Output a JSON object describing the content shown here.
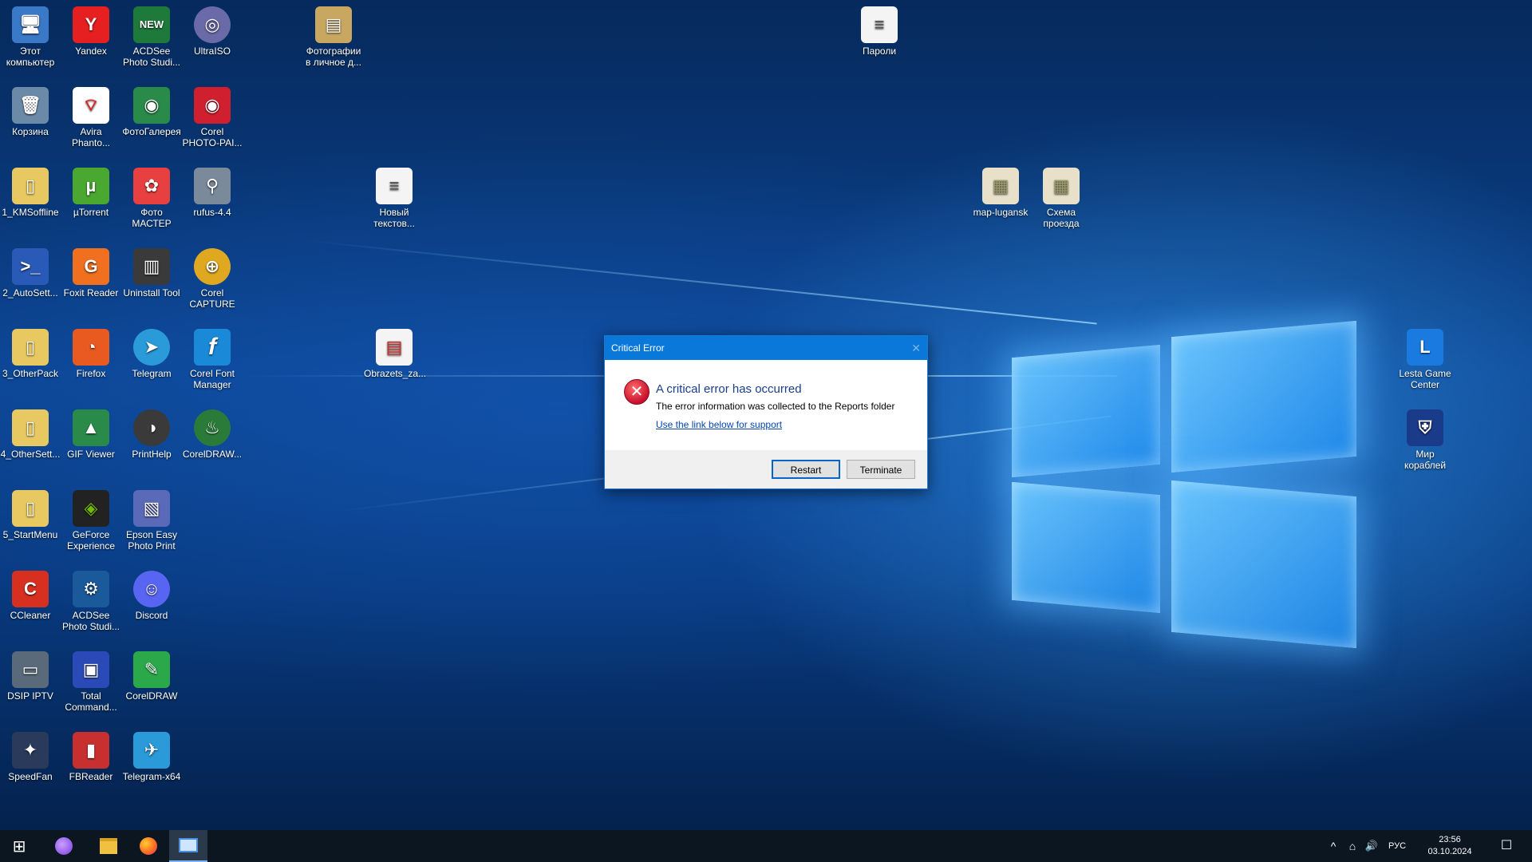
{
  "desktop": {
    "icons": [
      {
        "label": "Этот компьютер",
        "glyph": "🖥",
        "color": "#3a78c8"
      },
      {
        "label": "Yandex",
        "glyph": "Y",
        "color": "#e62020"
      },
      {
        "label": "ACDSee Photo Studi...",
        "glyph": "NEW",
        "color": "#1e7a3a"
      },
      {
        "label": "UltraISO",
        "glyph": "◎",
        "color": "#6a6aa8"
      },
      {
        "label": "Фотографии в личное д...",
        "glyph": "▤",
        "color": "#c8a860"
      },
      {
        "label": "Пароли",
        "glyph": "≡",
        "color": "#f4f4f4"
      },
      {
        "label": "Корзина",
        "glyph": "🗑",
        "color": "#6a8aa8"
      },
      {
        "label": "Avira Phanto...",
        "glyph": "⌔",
        "color": "#ffffff"
      },
      {
        "label": "ФотоГалерея",
        "glyph": "◉",
        "color": "#2a8a4a"
      },
      {
        "label": "Corel PHOTO-PAI...",
        "glyph": "◉",
        "color": "#d02030"
      },
      {
        "label": "1_KMSoffline",
        "glyph": "▯",
        "color": "#e8c860"
      },
      {
        "label": "µTorrent",
        "glyph": "µ",
        "color": "#4aa830"
      },
      {
        "label": "Фото МАСТЕР",
        "glyph": "✿",
        "color": "#e84040"
      },
      {
        "label": "rufus-4.4",
        "glyph": "⚲",
        "color": "#7a8a9a"
      },
      {
        "label": "Новый текстов...",
        "glyph": "≡",
        "color": "#f4f4f4"
      },
      {
        "label": "map-lugansk",
        "glyph": "▦",
        "color": "#e8e0c8"
      },
      {
        "label": "Схема проезда",
        "glyph": "▦",
        "color": "#e8e0c8"
      },
      {
        "label": "2_AutoSett...",
        "glyph": ">_",
        "color": "#2a5ab8"
      },
      {
        "label": "Foxit Reader",
        "glyph": "G",
        "color": "#f07020"
      },
      {
        "label": "Uninstall Tool",
        "glyph": "▥",
        "color": "#3a3a3a"
      },
      {
        "label": "Corel CAPTURE",
        "glyph": "⊕",
        "color": "#e0a820"
      },
      {
        "label": "3_OtherPack",
        "glyph": "▯",
        "color": "#e8c860"
      },
      {
        "label": "Firefox",
        "glyph": "◔",
        "color": "#e85a20"
      },
      {
        "label": "Telegram",
        "glyph": "➤",
        "color": "#2a9ad8"
      },
      {
        "label": "Corel Font Manager",
        "glyph": "f",
        "color": "#1a8ad8"
      },
      {
        "label": "Obrazets_za...",
        "glyph": "▤",
        "color": "#f4f4f4"
      },
      {
        "label": "Lesta Game Center",
        "glyph": "L",
        "color": "#1a7ae0"
      },
      {
        "label": "4_OtherSett...",
        "glyph": "▯",
        "color": "#e8c860"
      },
      {
        "label": "GIF Viewer",
        "glyph": "▲",
        "color": "#2a8a4a"
      },
      {
        "label": "PrintHelp",
        "glyph": "◑",
        "color": "#3a3a3a"
      },
      {
        "label": "CorelDRAW...",
        "glyph": "♨",
        "color": "#2a7a3a"
      },
      {
        "label": "Мир кораблей",
        "glyph": "⛨",
        "color": "#1a3a8a"
      },
      {
        "label": "5_StartMenu",
        "glyph": "▯",
        "color": "#e8c860"
      },
      {
        "label": "GeForce Experience",
        "glyph": "◈",
        "color": "#222222"
      },
      {
        "label": "Epson Easy Photo Print",
        "glyph": "▧",
        "color": "#5a6ab8"
      },
      {
        "label": "CCleaner",
        "glyph": "C",
        "color": "#d83020"
      },
      {
        "label": "ACDSee Photo Studi...",
        "glyph": "⚙",
        "color": "#1a5a9a"
      },
      {
        "label": "Discord",
        "glyph": "☺",
        "color": "#5865f2"
      },
      {
        "label": "DSIP IPTV",
        "glyph": "▭",
        "color": "#5a6a7a"
      },
      {
        "label": "Total Command...",
        "glyph": "▣",
        "color": "#2a4ab8"
      },
      {
        "label": "CorelDRAW",
        "glyph": "✎",
        "color": "#2aa84a"
      },
      {
        "label": "SpeedFan",
        "glyph": "✦",
        "color": "#2a3a5a"
      },
      {
        "label": "FBReader",
        "glyph": "▮",
        "color": "#c83030"
      },
      {
        "label": "Telegram-x64",
        "glyph": "✈",
        "color": "#2a9ad8"
      }
    ]
  },
  "dialog": {
    "title": "Critical Error",
    "close_glyph": "✕",
    "error_glyph": "✕",
    "heading": "A critical error has occurred",
    "message": "The error information was collected to the Reports folder",
    "link": "Use the link below for support",
    "restart_label": "Restart",
    "terminate_label": "Terminate"
  },
  "taskbar": {
    "start_glyph": "⊞",
    "tray_chevron": "^",
    "network_glyph": "⌂",
    "volume_glyph": "🔊",
    "language": "РУС",
    "time": "23:56",
    "date": "03.10.2024",
    "notification_glyph": "☐"
  }
}
